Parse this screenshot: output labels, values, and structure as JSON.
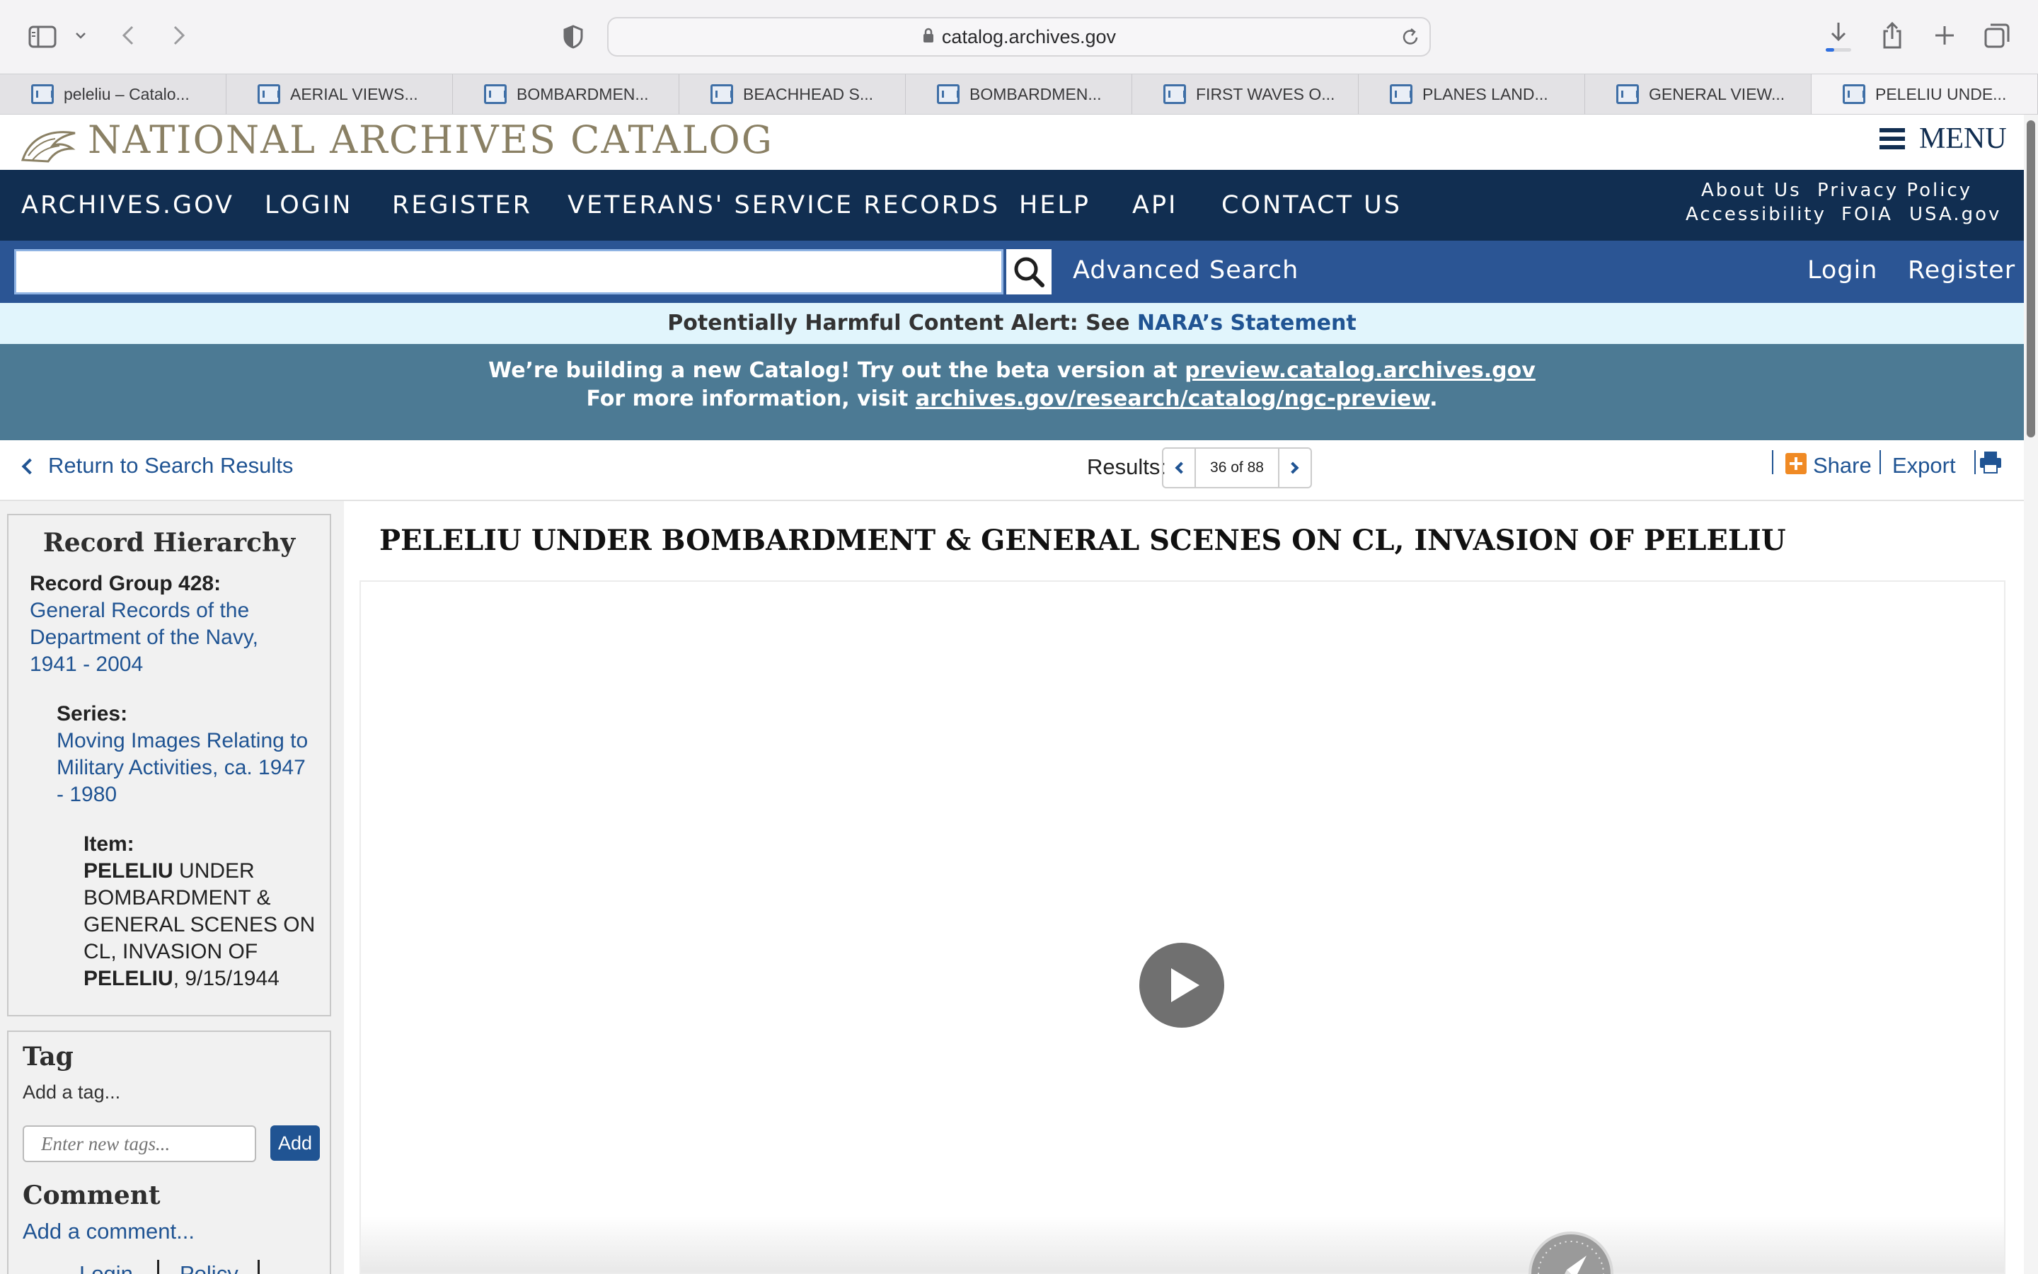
{
  "browser": {
    "url": "catalog.archives.gov",
    "tabs": [
      "peleliu – Catalo...",
      "AERIAL VIEWS...",
      "BOMBARDMEN...",
      "BEACHHEAD S...",
      "BOMBARDMEN...",
      "FIRST WAVES O...",
      "PLANES LAND...",
      "GENERAL VIEW...",
      "PELELIU UNDE..."
    ]
  },
  "header": {
    "logo_text": "NATIONAL ARCHIVES CATALOG",
    "menu_label": "MENU"
  },
  "nav": {
    "items": [
      "ARCHIVES.GOV",
      "LOGIN",
      "REGISTER",
      "VETERANS' SERVICE RECORDS",
      "HELP",
      "API",
      "CONTACT US"
    ],
    "util_row1": [
      "About Us",
      "Privacy Policy"
    ],
    "util_row2": [
      "Accessibility",
      "FOIA",
      "USA.gov"
    ]
  },
  "search": {
    "placeholder": "",
    "advanced": "Advanced Search",
    "login": "Login",
    "register": "Register"
  },
  "alert": {
    "prefix": "Potentially Harmful Content Alert: See ",
    "link": "NARA’s Statement"
  },
  "beta": {
    "line1_text": "We’re building a new Catalog! Try out the beta version at ",
    "line1_link": "preview.catalog.archives.gov",
    "line2_text": "For more information, visit ",
    "line2_link": "archives.gov/research/catalog/ngc-preview",
    "line2_end": "."
  },
  "results": {
    "return_label": "Return to Search Results",
    "label": "Results:",
    "count": "36 of 88",
    "share": "Share",
    "export": "Export"
  },
  "hierarchy": {
    "title": "Record Hierarchy",
    "group_label": "Record Group 428:",
    "group_lines": [
      "General Records of the",
      "Department of the Navy,",
      "1941 - 2004"
    ],
    "series_label": "Series:",
    "series_lines": [
      "Moving Images Relating to",
      "Military Activities, ca. 1947",
      "- 1980"
    ],
    "item_label": "Item:",
    "item_l1_bold": "PELELIU",
    "item_l1_rest": " UNDER",
    "item_l2": "BOMBARDMENT &",
    "item_l3": "GENERAL SCENES ON",
    "item_l4": "CL, INVASION OF",
    "item_l5_bold": "PELELIU",
    "item_l5_rest": ", 9/15/1944"
  },
  "tag": {
    "title": "Tag",
    "hint": "Add a tag...",
    "placeholder": "Enter new tags...",
    "add_button": "Add",
    "comment_title": "Comment",
    "add_comment": "Add a comment...",
    "footer_links": [
      "Login",
      "Policy"
    ]
  },
  "record": {
    "title": "PELELIU UNDER BOMBARDMENT & GENERAL SCENES ON CL, INVASION OF PELELIU"
  },
  "colors": {
    "navy": "#112e51",
    "search_blue": "#2b5594",
    "link_blue": "#205493",
    "alert_bg": "#e1f5fc",
    "beta_bg": "#4c7a94"
  }
}
